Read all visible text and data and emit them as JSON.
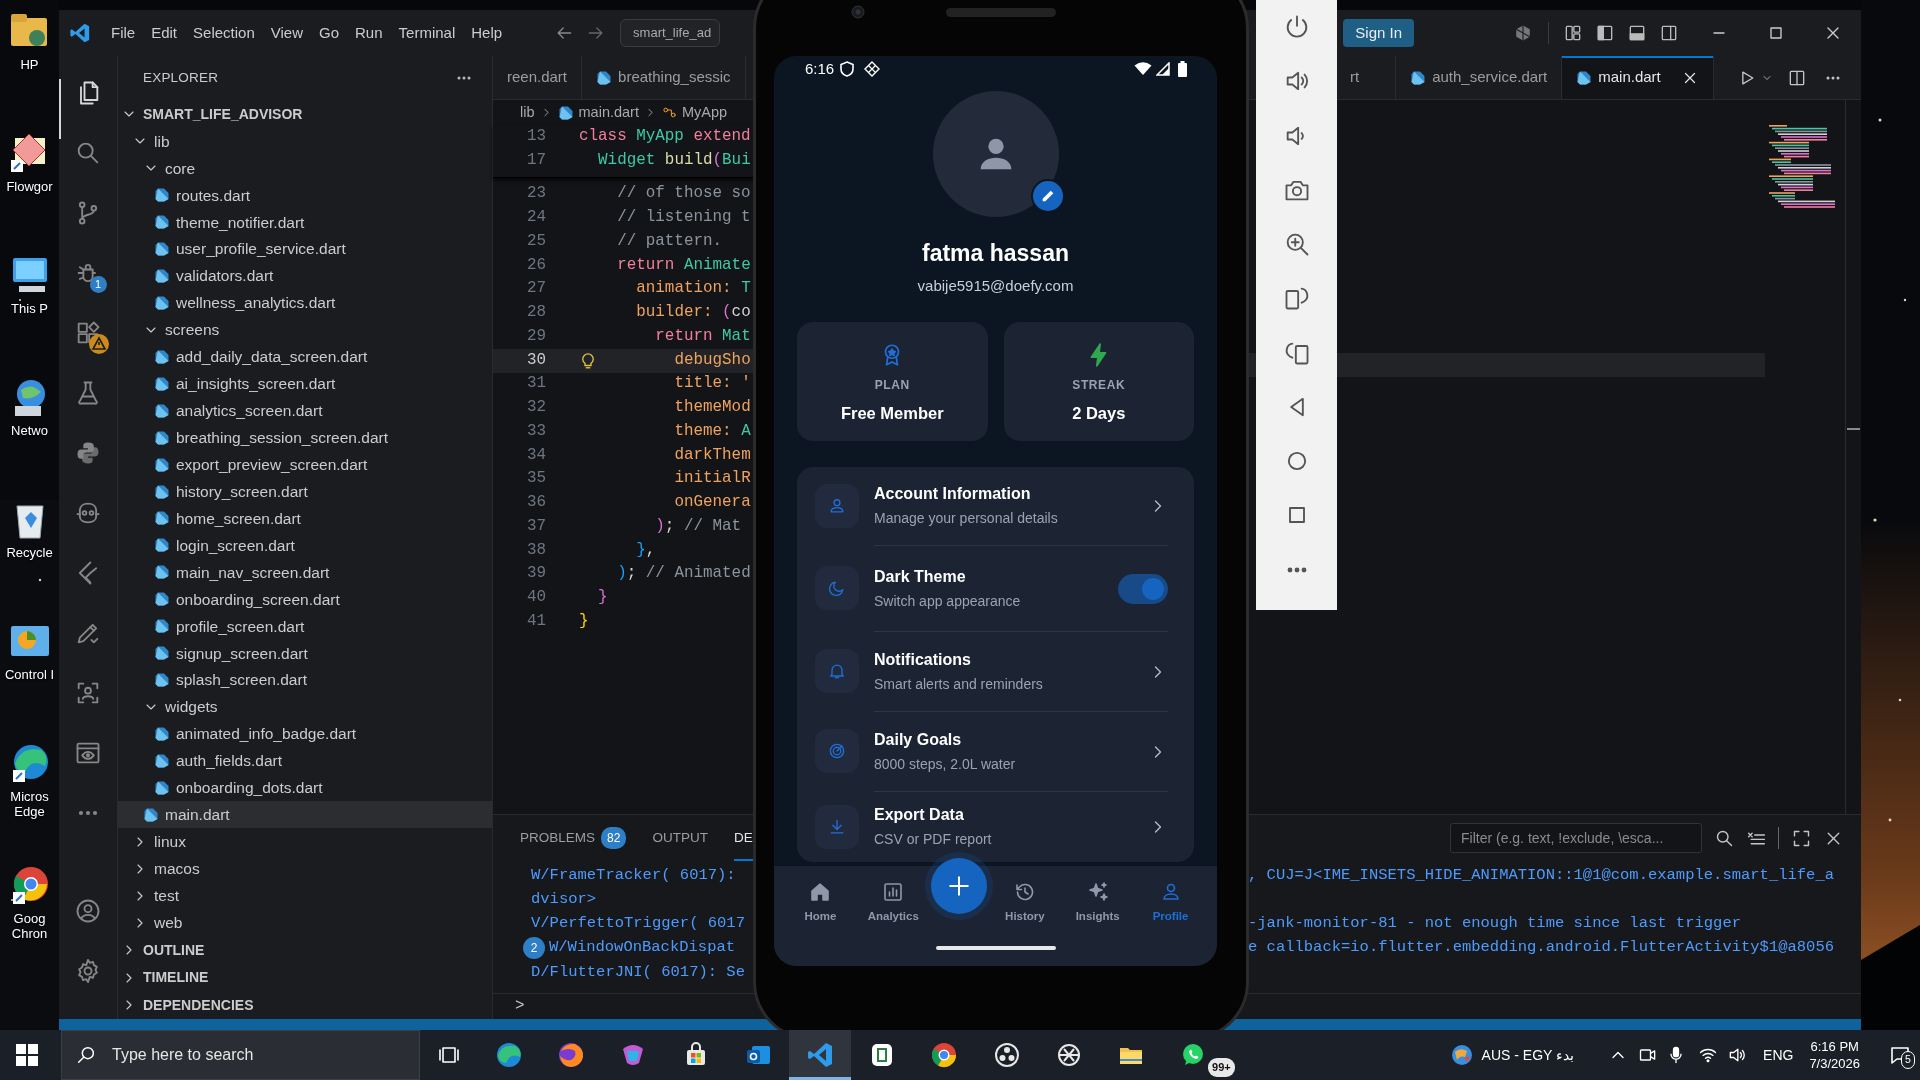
{
  "desktop_icons": [
    {
      "label": "HP"
    },
    {
      "label": "Flowgor"
    },
    {
      "label": "This P"
    },
    {
      "label": "Netwo"
    },
    {
      "label": "Recycle"
    },
    {
      "label": "Control I"
    },
    {
      "label": "Micros Edge"
    },
    {
      "label": "Goog Chron"
    }
  ],
  "vscode": {
    "menu": [
      "File",
      "Edit",
      "Selection",
      "View",
      "Go",
      "Run",
      "Terminal",
      "Help"
    ],
    "command_center": "smart_life_ad",
    "sign_in": "Sign In",
    "activity_bar": [
      {
        "selected": true,
        "warning": false
      },
      {
        "selected": false,
        "warning": false
      },
      {
        "selected": false,
        "warning": false
      },
      {
        "selected": false,
        "warning": false,
        "badge": "1"
      },
      {
        "selected": false,
        "warning": true
      },
      {
        "selected": false,
        "warning": false
      },
      {
        "selected": false,
        "warning": false
      },
      {
        "selected": false,
        "warning": false
      },
      {
        "selected": false,
        "warning": false
      },
      {
        "selected": false,
        "warning": false
      },
      {
        "selected": false,
        "warning": false
      },
      {
        "selected": false,
        "warning": false
      },
      {
        "selected": false,
        "warning": false
      }
    ],
    "explorer": {
      "title": "EXPLORER",
      "project": "SMART_LIFE_ADVISOR",
      "tree": [
        {
          "label": "lib",
          "kind": "folder",
          "expanded": true,
          "selected": false,
          "children": [
            {
              "label": "core",
              "kind": "folder",
              "expanded": true,
              "selected": false,
              "children": [
                {
                  "label": "routes.dart",
                  "kind": "file",
                  "selected": false
                },
                {
                  "label": "theme_notifier.dart",
                  "kind": "file",
                  "selected": false
                },
                {
                  "label": "user_profile_service.dart",
                  "kind": "file",
                  "selected": false
                },
                {
                  "label": "validators.dart",
                  "kind": "file",
                  "selected": false
                },
                {
                  "label": "wellness_analytics.dart",
                  "kind": "file",
                  "selected": false
                }
              ]
            },
            {
              "label": "screens",
              "kind": "folder",
              "expanded": true,
              "selected": false,
              "children": [
                {
                  "label": "add_daily_data_screen.dart",
                  "kind": "file",
                  "selected": false
                },
                {
                  "label": "ai_insights_screen.dart",
                  "kind": "file",
                  "selected": false
                },
                {
                  "label": "analytics_screen.dart",
                  "kind": "file",
                  "selected": false
                },
                {
                  "label": "breathing_session_screen.dart",
                  "kind": "file",
                  "selected": false
                },
                {
                  "label": "export_preview_screen.dart",
                  "kind": "file",
                  "selected": false
                },
                {
                  "label": "history_screen.dart",
                  "kind": "file",
                  "selected": false
                },
                {
                  "label": "home_screen.dart",
                  "kind": "file",
                  "selected": false
                },
                {
                  "label": "login_screen.dart",
                  "kind": "file",
                  "selected": false
                },
                {
                  "label": "main_nav_screen.dart",
                  "kind": "file",
                  "selected": false
                },
                {
                  "label": "onboarding_screen.dart",
                  "kind": "file",
                  "selected": false
                },
                {
                  "label": "profile_screen.dart",
                  "kind": "file",
                  "selected": false
                },
                {
                  "label": "signup_screen.dart",
                  "kind": "file",
                  "selected": false
                },
                {
                  "label": "splash_screen.dart",
                  "kind": "file",
                  "selected": false
                }
              ]
            },
            {
              "label": "widgets",
              "kind": "folder",
              "expanded": true,
              "selected": false,
              "children": [
                {
                  "label": "animated_info_badge.dart",
                  "kind": "file",
                  "selected": false
                },
                {
                  "label": "auth_fields.dart",
                  "kind": "file",
                  "selected": false
                },
                {
                  "label": "onboarding_dots.dart",
                  "kind": "file",
                  "selected": false
                }
              ]
            },
            {
              "label": "main.dart",
              "kind": "file",
              "selected": true
            }
          ]
        },
        {
          "label": "linux",
          "kind": "folder",
          "expanded": false,
          "selected": false
        },
        {
          "label": "macos",
          "kind": "folder",
          "expanded": false,
          "selected": false
        },
        {
          "label": "test",
          "kind": "folder",
          "expanded": false,
          "selected": false
        },
        {
          "label": "web",
          "kind": "folder",
          "expanded": false,
          "selected": false
        }
      ],
      "sections": [
        "OUTLINE",
        "TIMELINE",
        "DEPENDENCIES"
      ]
    },
    "tabs_left": [
      {
        "label": "reen.dart",
        "icon": false,
        "selected": false
      },
      {
        "label": "breathing_sessic",
        "icon": true,
        "selected": false
      }
    ],
    "tabs_right": [
      {
        "label": "rt",
        "icon": false,
        "selected": false
      },
      {
        "label": "auth_service.dart",
        "icon": true,
        "selected": false
      },
      {
        "label": "main.dart",
        "icon": true,
        "selected": true
      }
    ],
    "breadcrumb": [
      "lib",
      "main.dart",
      "MyApp"
    ],
    "sticky_lines": [
      {
        "number": "13",
        "tokens": [
          {
            "t": "class ",
            "color": "#f47f9d"
          },
          {
            "t": "MyApp ",
            "color": "#3ec9a7"
          },
          {
            "t": "extend",
            "color": "#f47f9d"
          }
        ]
      },
      {
        "number": "17",
        "tokens": [
          {
            "t": "  Widget ",
            "color": "#3ec9a7"
          },
          {
            "t": "build",
            "color": "#dcdcaa"
          },
          {
            "t": "(",
            "color": "#da70d6"
          },
          {
            "t": "Bui",
            "color": "#3ec9a7"
          }
        ]
      }
    ],
    "code_lines": [
      {
        "number": "23",
        "current": false,
        "lightbulb": false,
        "tokens": [
          {
            "t": "    // of those so",
            "color": "#8b949e"
          }
        ]
      },
      {
        "number": "24",
        "current": false,
        "lightbulb": false,
        "tokens": [
          {
            "t": "    // listening t",
            "color": "#8b949e"
          }
        ]
      },
      {
        "number": "25",
        "current": false,
        "lightbulb": false,
        "tokens": [
          {
            "t": "    // pattern.",
            "color": "#8b949e"
          }
        ]
      },
      {
        "number": "26",
        "current": false,
        "lightbulb": false,
        "tokens": [
          {
            "t": "    return ",
            "color": "#f47f9d"
          },
          {
            "t": "Animate",
            "color": "#3ec9a7"
          }
        ]
      },
      {
        "number": "27",
        "current": false,
        "lightbulb": false,
        "tokens": [
          {
            "t": "      animation: ",
            "color": "#f0a35e"
          },
          {
            "t": "T",
            "color": "#3ec9a7"
          }
        ]
      },
      {
        "number": "28",
        "current": false,
        "lightbulb": false,
        "tokens": [
          {
            "t": "      builder: ",
            "color": "#f0a35e"
          },
          {
            "t": "(",
            "color": "#da70d6"
          },
          {
            "t": "co",
            "color": "#d4d4d4"
          }
        ]
      },
      {
        "number": "29",
        "current": false,
        "lightbulb": false,
        "tokens": [
          {
            "t": "        return ",
            "color": "#f47f9d"
          },
          {
            "t": "Mat",
            "color": "#3ec9a7"
          }
        ]
      },
      {
        "number": "30",
        "current": true,
        "lightbulb": true,
        "tokens": [
          {
            "t": "          debugSho",
            "color": "#f0a35e"
          }
        ]
      },
      {
        "number": "31",
        "current": false,
        "lightbulb": false,
        "tokens": [
          {
            "t": "          title: '",
            "color": "#f0a35e"
          }
        ]
      },
      {
        "number": "32",
        "current": false,
        "lightbulb": false,
        "tokens": [
          {
            "t": "          themeMod",
            "color": "#f0a35e"
          }
        ]
      },
      {
        "number": "33",
        "current": false,
        "lightbulb": false,
        "tokens": [
          {
            "t": "          theme: ",
            "color": "#f0a35e"
          },
          {
            "t": "A",
            "color": "#3ec9a7"
          }
        ]
      },
      {
        "number": "34",
        "current": false,
        "lightbulb": false,
        "tokens": [
          {
            "t": "          darkThem",
            "color": "#f0a35e"
          }
        ]
      },
      {
        "number": "35",
        "current": false,
        "lightbulb": false,
        "tokens": [
          {
            "t": "          initialR",
            "color": "#f0a35e"
          }
        ]
      },
      {
        "number": "36",
        "current": false,
        "lightbulb": false,
        "tokens": [
          {
            "t": "          onGenera",
            "color": "#f0a35e"
          }
        ]
      },
      {
        "number": "37",
        "current": false,
        "lightbulb": false,
        "tokens": [
          {
            "t": "        )",
            "color": "#da70d6"
          },
          {
            "t": "; ",
            "color": "#d4d4d4"
          },
          {
            "t": "// Mat",
            "color": "#8b949e"
          }
        ]
      },
      {
        "number": "38",
        "current": false,
        "lightbulb": false,
        "tokens": [
          {
            "t": "      }",
            "color": "#179fff"
          },
          {
            "t": ",",
            "color": "#d4d4d4"
          }
        ]
      },
      {
        "number": "39",
        "current": false,
        "lightbulb": false,
        "tokens": [
          {
            "t": "    )",
            "color": "#179fff"
          },
          {
            "t": "; ",
            "color": "#d4d4d4"
          },
          {
            "t": "// Animated",
            "color": "#8b949e"
          }
        ]
      },
      {
        "number": "40",
        "current": false,
        "lightbulb": false,
        "tokens": [
          {
            "t": "  }",
            "color": "#da70d6"
          }
        ]
      },
      {
        "number": "41",
        "current": false,
        "lightbulb": false,
        "tokens": [
          {
            "t": "}",
            "color": "#ffd700"
          }
        ]
      }
    ],
    "panel": {
      "tabs": [
        {
          "label": "PROBLEMS",
          "count": "82",
          "selected": false
        },
        {
          "label": "OUTPUT",
          "selected": false
        },
        {
          "label": "DE",
          "selected": true
        }
      ],
      "filter_placeholder": "Filter (e.g. text, !exclude, \\esca...",
      "log_rows": [
        {
          "left": "W/FrameTracker( 6017):",
          "right": ", CUJ=J<IME_INSETS_HIDE_ANIMATION::1@1@com.example.smart_life_a"
        },
        {
          "left": "dvisor>"
        },
        {
          "left": "V/PerfettoTrigger( 6017",
          "right": "-jank-monitor-81 - not enough time since last trigger"
        },
        {
          "left": "W/WindowOnBackDispat",
          "count": "2",
          "right": "e callback=io.flutter.embedding.android.FlutterActivity$1@a8056"
        },
        {
          "left": "D/FlutterJNI( 6017): Se"
        }
      ],
      "prompt": ">"
    }
  },
  "phone": {
    "time": "6:16",
    "name": "fatma hassan",
    "email": "vabije5915@doefy.com",
    "stats": [
      {
        "label": "PLAN",
        "value": "Free Member",
        "color": "#1e6fd9"
      },
      {
        "label": "STREAK",
        "value": "2 Days",
        "color": "#2fa84f"
      }
    ],
    "settings": [
      {
        "kind": "link",
        "title": "Account Information",
        "subtitle": "Manage your personal details"
      },
      {
        "kind": "toggle",
        "title": "Dark Theme",
        "subtitle": "Switch app appearance",
        "on": true
      },
      {
        "kind": "link",
        "title": "Notifications",
        "subtitle": "Smart alerts and reminders"
      },
      {
        "kind": "link",
        "title": "Daily Goals",
        "subtitle": "8000 steps, 2.0L water"
      },
      {
        "kind": "link",
        "title": "Export Data",
        "subtitle": "CSV or PDF report"
      }
    ],
    "nav": [
      {
        "label": "Home",
        "selected": false
      },
      {
        "label": "Analytics",
        "selected": false
      },
      {
        "label": "History",
        "selected": false
      },
      {
        "label": "Insights",
        "selected": false
      },
      {
        "label": "Profile",
        "selected": true
      }
    ]
  },
  "taskbar": {
    "search_placeholder": "Type here to search",
    "apps": [
      {
        "selected": false
      },
      {
        "selected": false
      },
      {
        "selected": false
      },
      {
        "selected": false
      },
      {
        "selected": false
      },
      {
        "selected": true
      },
      {
        "selected": false
      },
      {
        "selected": false
      },
      {
        "selected": false
      },
      {
        "selected": false
      },
      {
        "selected": false
      },
      {
        "selected": false,
        "badge": "99+"
      }
    ],
    "keyboard_layout": "AUS - EGY بدء",
    "input_language": "ENG",
    "time": "6:16 PM",
    "date": "7/3/2026",
    "notifications": "5"
  }
}
